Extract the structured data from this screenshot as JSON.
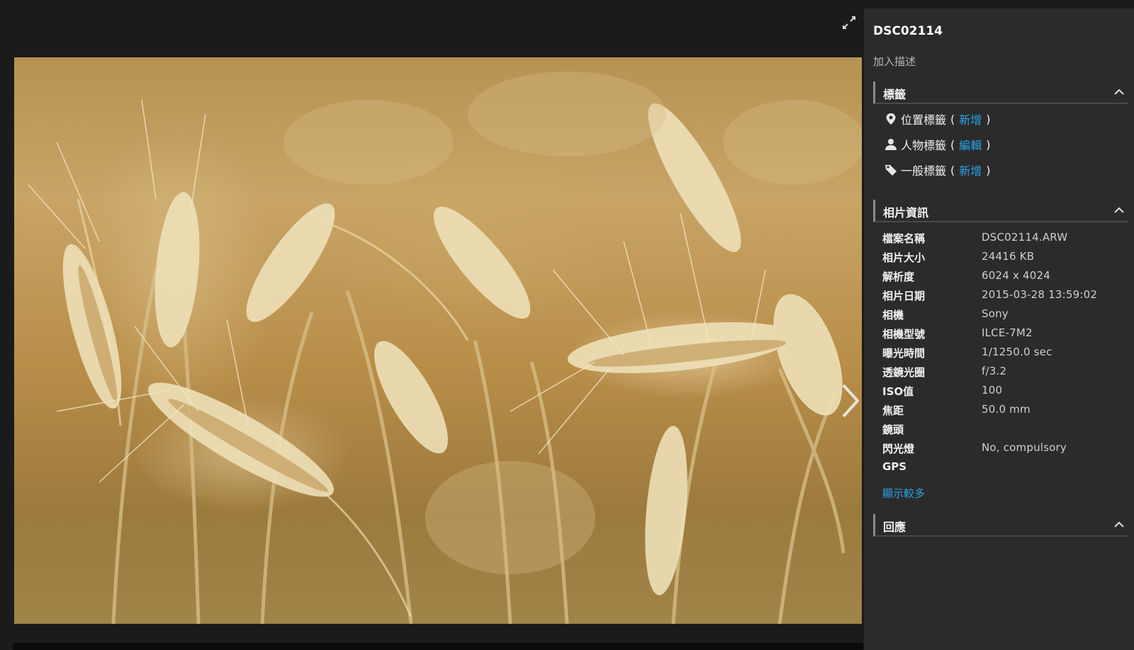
{
  "photo": {
    "title": "DSC02114",
    "add_description": "加入描述"
  },
  "sections": {
    "tags": "標籤",
    "photo_info": "相片資訊",
    "comments": "回應"
  },
  "tags": [
    {
      "icon": "location-pin-icon",
      "label": "位置標籤",
      "open": "(",
      "action": "新增",
      "close": ")"
    },
    {
      "icon": "person-icon",
      "label": "人物標籤",
      "open": "(",
      "action": "編輯",
      "close": ")"
    },
    {
      "icon": "tag-icon",
      "label": "一般標籤",
      "open": "(",
      "action": "新增",
      "close": ")"
    }
  ],
  "info": [
    {
      "key": "檔案名稱",
      "value": "DSC02114.ARW"
    },
    {
      "key": "相片大小",
      "value": "24416 KB"
    },
    {
      "key": "解析度",
      "value": "6024 x 4024"
    },
    {
      "key": "相片日期",
      "value": "2015-03-28 13:59:02"
    },
    {
      "key": "相機",
      "value": "Sony"
    },
    {
      "key": "相機型號",
      "value": "ILCE-7M2"
    },
    {
      "key": "曝光時間",
      "value": "1/1250.0 sec"
    },
    {
      "key": "透鏡光圈",
      "value": "f/3.2"
    },
    {
      "key": "ISO值",
      "value": "100"
    },
    {
      "key": "焦距",
      "value": "50.0 mm"
    },
    {
      "key": "鏡頭",
      "value": ""
    },
    {
      "key": "閃光燈",
      "value": "No, compulsory"
    },
    {
      "key": "GPS",
      "value": ""
    }
  ],
  "show_more": "顯示較多",
  "colors": {
    "link": "#2ba2e6",
    "panel_bg": "#2b2b2b",
    "viewer_bg": "#1b1b1b"
  }
}
